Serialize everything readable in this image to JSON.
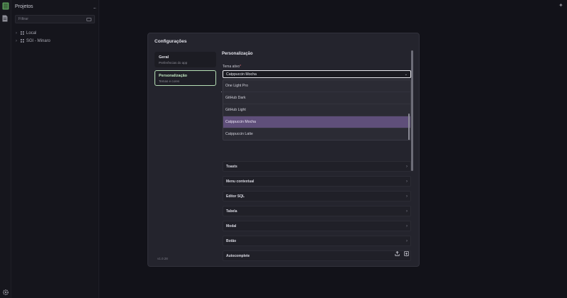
{
  "sidebar": {
    "title": "Projetos",
    "more": "...",
    "filter_placeholder": "Filtrar",
    "tree": [
      {
        "label": "Local"
      },
      {
        "label": "SGI - Minaro"
      }
    ]
  },
  "dialog": {
    "title": "Configurações",
    "nav": [
      {
        "label": "Geral",
        "sub": "Preferências do app"
      },
      {
        "label": "Personalização",
        "sub": "Temas e cores"
      }
    ],
    "version": "v1.0.28",
    "section_title": "Personalização",
    "field_label": "Tema ativo",
    "required_mark": "*",
    "selected_theme": "Catppuccin Mocha",
    "dropdown_options": [
      {
        "label": "One Light Pro",
        "selected": false
      },
      {
        "label": "GitHub Dark",
        "selected": false
      },
      {
        "label": "GitHub Light",
        "selected": false
      },
      {
        "label": "Catppuccin Mocha",
        "selected": true
      },
      {
        "label": "Catppuccin Latte",
        "selected": false
      }
    ],
    "sections": [
      {
        "label": "Toasts"
      },
      {
        "label": "Menu contextual"
      },
      {
        "label": "Editor SQL"
      },
      {
        "label": "Tabela"
      },
      {
        "label": "Modal"
      },
      {
        "label": "Botão"
      },
      {
        "label": "Autocomplete"
      }
    ]
  },
  "colors": {
    "background": "#121219",
    "dialog": "#24242d",
    "accent_green": "#b6e0b6",
    "selected_option": "#5f4f7a"
  },
  "icons": [
    "database-icon",
    "file-icon",
    "gear-icon",
    "sparkle-icon",
    "export-icon",
    "import-icon"
  ]
}
